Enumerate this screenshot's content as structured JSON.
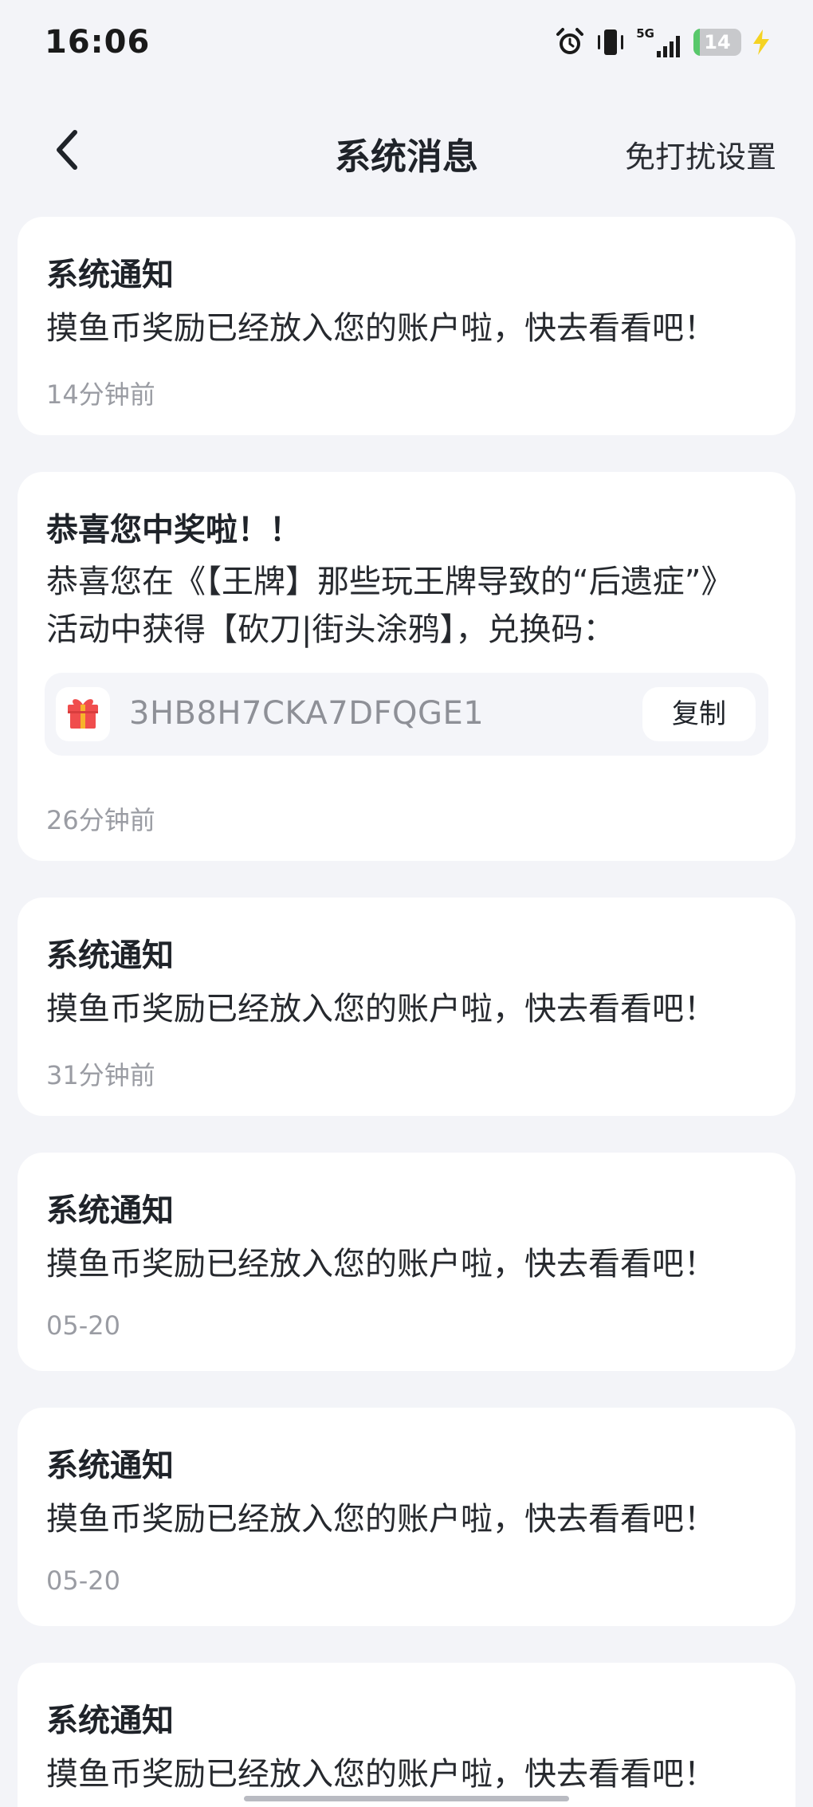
{
  "status_bar": {
    "time": "16:06",
    "network": "5G",
    "battery_level": "14",
    "battery_fraction": 0.14,
    "icons": [
      "alarm-icon",
      "vibrate-icon",
      "signal-icon",
      "battery-icon",
      "charging-icon"
    ]
  },
  "nav": {
    "back_icon": "chevron-left-icon",
    "title": "系统消息",
    "action_label": "免打扰设置"
  },
  "messages": [
    {
      "title": "系统通知",
      "body": "摸鱼币奖励已经放入您的账户啦，快去看看吧！",
      "time": "14分钟前"
    },
    {
      "title": "恭喜您中奖啦！！",
      "body_line1": "恭喜您在《【王牌】那些玩王牌导致的“后遗症”》",
      "body_line2": "活动中获得【砍刀|街头涂鸦】，兑换码：",
      "code": "3HB8H7CKA7DFQGE1",
      "copy_label": "复制",
      "gift_icon": "gift-icon",
      "time": "26分钟前"
    },
    {
      "title": "系统通知",
      "body": "摸鱼币奖励已经放入您的账户啦，快去看看吧！",
      "time": "31分钟前"
    },
    {
      "title": "系统通知",
      "body": "摸鱼币奖励已经放入您的账户啦，快去看看吧！",
      "time": "05-20"
    },
    {
      "title": "系统通知",
      "body": "摸鱼币奖励已经放入您的账户啦，快去看看吧！",
      "time": "05-20"
    },
    {
      "title": "系统通知",
      "body": "摸鱼币奖励已经放入您的账户啦，快去看看吧！"
    }
  ],
  "colors": {
    "background": "#f3f4f8",
    "card": "#ffffff",
    "title_text": "#1f2329",
    "muted_text": "#9a9ca3",
    "code_box": "#f4f5f9",
    "gift_red": "#f04d4d",
    "gift_gold": "#f7b32b",
    "battery_green": "#58c86b",
    "charging_yellow": "#f5d323"
  }
}
